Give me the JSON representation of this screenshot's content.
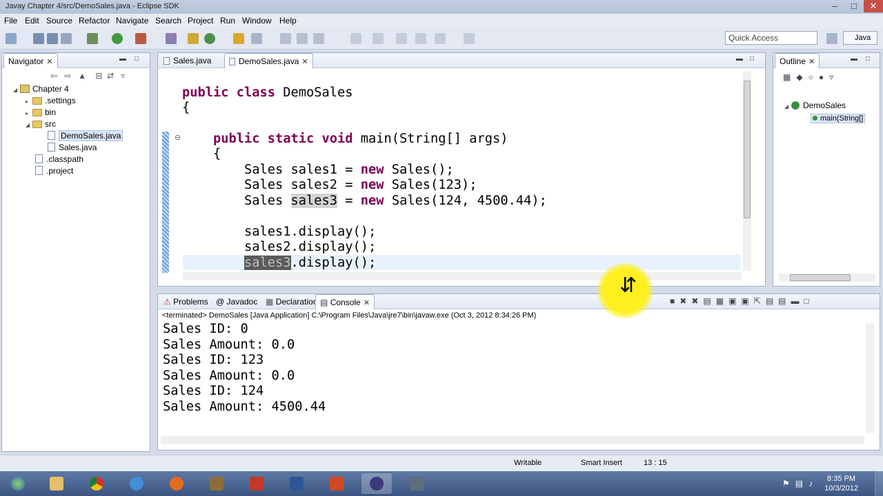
{
  "window": {
    "title": "Javay Chapter 4/src/DemoSales.java - Eclipse SDK"
  },
  "menu": [
    "File",
    "Edit",
    "Source",
    "Refactor",
    "Navigate",
    "Search",
    "Project",
    "Run",
    "Window",
    "Help"
  ],
  "toolbar": {
    "quick_access_placeholder": "Quick Access",
    "perspective_label": "Java"
  },
  "navigator": {
    "title": "Navigator",
    "items": [
      {
        "label": "Chapter 4",
        "type": "project"
      },
      {
        "label": ".settings",
        "type": "folder"
      },
      {
        "label": "bin",
        "type": "folder"
      },
      {
        "label": "src",
        "type": "folder"
      },
      {
        "label": "DemoSales.java",
        "type": "file",
        "selected": true
      },
      {
        "label": "Sales.java",
        "type": "file"
      },
      {
        "label": ".classpath",
        "type": "file"
      },
      {
        "label": ".project",
        "type": "file"
      }
    ]
  },
  "editor": {
    "tabs": [
      {
        "label": "Sales.java",
        "active": false
      },
      {
        "label": "DemoSales.java",
        "active": true
      }
    ],
    "code": {
      "l1_kw": "public class",
      "l1_rest": " DemoSales",
      "l2": "{",
      "l3_kw1": "public static void",
      "l3_rest": " main(String[] args)",
      "l4": "{",
      "l5_a": "Sales sales1 = ",
      "l5_kw": "new",
      "l5_b": " Sales();",
      "l6_a": "Sales sales2 = ",
      "l6_kw": "new",
      "l6_b": " Sales(123);",
      "l7_a": "Sales ",
      "l7_hl": "sales3",
      "l7_b": " = ",
      "l7_kw": "new",
      "l7_c": " Sales(124, 4500.44);",
      "l8": "sales1.display();",
      "l9": "sales2.display();",
      "l10_hl": "sales3",
      "l10_b": ".display();"
    }
  },
  "outline": {
    "title": "Outline",
    "class_name": "DemoSales",
    "method": "main(String[]"
  },
  "bottom_panel": {
    "tabs": [
      {
        "label": "Problems",
        "active": false
      },
      {
        "label": "Javadoc",
        "active": false
      },
      {
        "label": "Declaration",
        "active": false
      },
      {
        "label": "Console",
        "active": true
      }
    ],
    "terminated_line": "<terminated> DemoSales [Java Application] C:\\Program Files\\Java\\jre7\\bin\\javaw.exe (Oct 3, 2012 8:34:26 PM)",
    "output": [
      "Sales ID: 0",
      "Sales Amount: 0.0",
      "Sales ID: 123",
      "Sales Amount: 0.0",
      "Sales ID: 124",
      "Sales Amount: 4500.44"
    ]
  },
  "status": {
    "writable": "Writable",
    "insert_mode": "Smart Insert",
    "position": "13 : 15"
  },
  "clock": {
    "time": "8:35 PM",
    "date": "10/3/2012"
  },
  "colors": {
    "keyword": "#7f0055",
    "highlight": "#d4d4d4",
    "cursor_spot": "#ffef1e"
  }
}
